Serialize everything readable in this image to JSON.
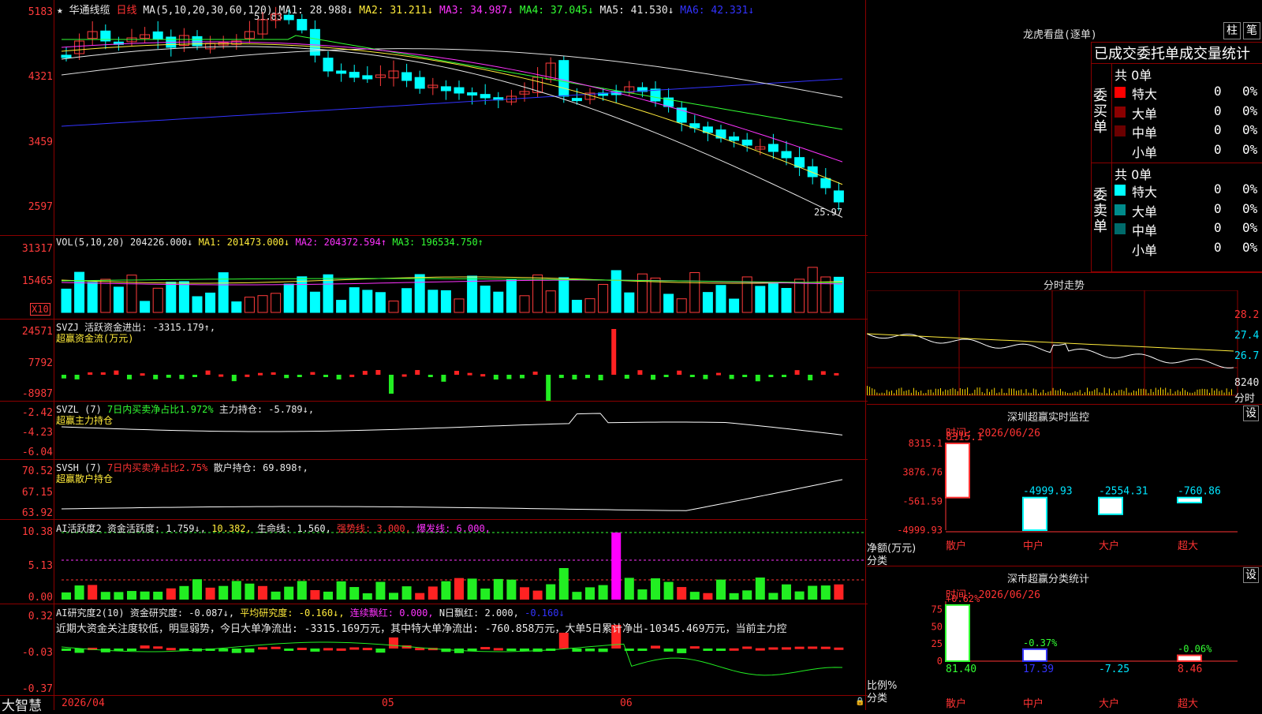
{
  "header": {
    "star": "★",
    "stock_name": "华通线缆",
    "period": "日线",
    "ma_params": "MA(5,10,20,30,60,120)",
    "ma1": "MA1: 28.988↓",
    "ma2": "MA2: 31.211↓",
    "ma3": "MA3: 34.987↓",
    "ma4": "MA4: 37.045↓",
    "ma5": "MA5: 41.530↓",
    "ma6": "MA6: 42.331↓",
    "high_mark": "51.83",
    "low_mark": "25.97"
  },
  "price_axis": [
    "5183",
    "4321",
    "3459",
    "2597"
  ],
  "vol": {
    "caption": "VOL(5,10,20)",
    "value": "204226.000↓",
    "ma1": "MA1: 201473.000↓",
    "ma2": "MA2: 204372.594↑",
    "ma3": "MA3: 196534.750↑",
    "axis": [
      "31317",
      "15465"
    ],
    "unit": "X10"
  },
  "svzj": {
    "caption": "SVZJ  活跃资金进出: -3315.179↑,",
    "sub": "超赢资金流(万元)",
    "axis": [
      "24571",
      "7792",
      "-8987"
    ]
  },
  "svzl": {
    "caption_a": "SVZL (7)",
    "caption_b": "7日内买卖净占比1.972%",
    "caption_c": "主力持仓: -5.789↓,",
    "sub": "超赢主力持仓",
    "axis": [
      "-2.42",
      "-4.23",
      "-6.04"
    ]
  },
  "svsh": {
    "caption_a": "SVSH (7)",
    "caption_b": "7日内买卖净占比2.75%",
    "caption_c": "散户持仓: 69.898↑,",
    "sub": "超赢散户持仓",
    "axis": [
      "70.52",
      "67.15",
      "63.92"
    ]
  },
  "ai1": {
    "a": "AI活跃度2",
    "b": "资金活跃度: 1.759↓,",
    "c": "10.382,",
    "d": "生命线: 1.560,",
    "e": "强势线: 3.000,",
    "f": "爆发线: 6.000,",
    "axis": [
      "10.38",
      "5.13",
      "0.00"
    ]
  },
  "ai2": {
    "a": "AI研究度2(10)",
    "b": "资金研究度: -0.087↓,",
    "c": "平均研究度: -0.160↓,",
    "d": "连续飘红: 0.000,",
    "e": "N日飘红: 2.000,",
    "f": "-0.160↓",
    "comment": "近期大资金关注度较低，明显弱势，今日大单净流出: -3315.169万元，其中特大单净流出: -760.858万元，大单5日累计净出-10345.469万元，当前主力控",
    "axis": [
      "0.32",
      "-0.03",
      "-0.37"
    ]
  },
  "date_axis": {
    "d1": "2026/04",
    "d2": "05",
    "d3": "06"
  },
  "brand": "大智慧",
  "right": {
    "lhb_title": "龙虎看盘(逐单)",
    "btn_zhu": "柱",
    "btn_bi": "笔",
    "table_head": "已成交委托单成交量统计",
    "buy_label": "委买单",
    "sell_label": "委卖单",
    "buy_total": "共 0单",
    "sell_total": "共 0单",
    "buy_rows": [
      {
        "name": "特大",
        "count": "0",
        "pct": "0%",
        "color": "#ff0000"
      },
      {
        "name": "大单",
        "count": "0",
        "pct": "0%",
        "color": "#8b0000"
      },
      {
        "name": "中单",
        "count": "0",
        "pct": "0%",
        "color": "#6b0000"
      },
      {
        "name": "小单",
        "count": "0",
        "pct": "0%",
        "color": ""
      }
    ],
    "sell_rows": [
      {
        "name": "特大",
        "count": "0",
        "pct": "0%",
        "color": "#00ffff"
      },
      {
        "name": "大单",
        "count": "0",
        "pct": "0%",
        "color": "#008b8b"
      },
      {
        "name": "中单",
        "count": "0",
        "pct": "0%",
        "color": "#006b6b"
      },
      {
        "name": "小单",
        "count": "0",
        "pct": "0%",
        "color": ""
      }
    ],
    "fs_title": "分时走势",
    "fs_axis": [
      "28.2",
      "27.4",
      "26.7",
      "8240",
      "分时"
    ],
    "sz_title": "深圳超赢实时监控",
    "sz_btn": "设",
    "sz_date": "时间: 2026/06/26",
    "sz_axis": [
      "8315.1",
      "3876.76",
      "-561.59",
      "-4999.93"
    ],
    "sz_unit_a": "净额(万元)",
    "sz_unit_b": "分类",
    "sz_values": [
      "8315.1",
      "-4999.93",
      "-2554.31",
      "-760.86"
    ],
    "sz_cats": [
      "散户",
      "中户",
      "大户",
      "超大"
    ],
    "cls_title": "深市超赢分类统计",
    "cls_btn": "设",
    "cls_date": "时间: 2026/06/26",
    "cls_axis": [
      "75",
      "50",
      "25",
      "0"
    ],
    "cls_unit_a": "比例%",
    "cls_unit_b": "分类",
    "cls_top": [
      "+0.62%",
      "-0.37%",
      "",
      "-0.06%"
    ],
    "cls_values": [
      "81.40",
      "17.39",
      "-7.25",
      "8.46"
    ],
    "cls_cats": [
      "散户",
      "中户",
      "大户",
      "超大"
    ]
  }
}
